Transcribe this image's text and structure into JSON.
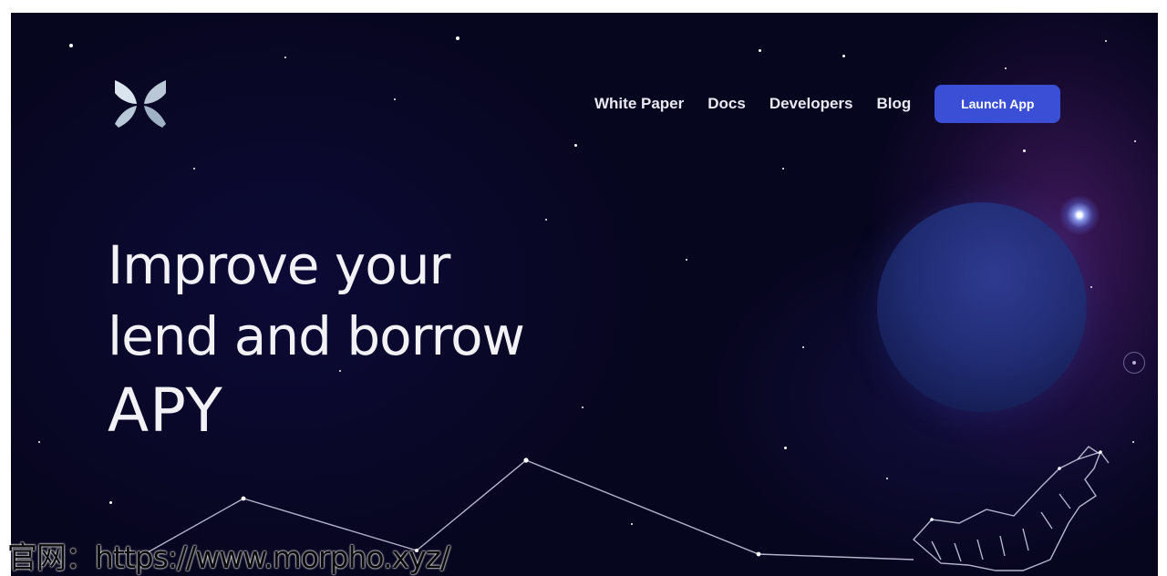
{
  "brand": {
    "logo_icon": "butterfly-logo-icon"
  },
  "nav": {
    "items": [
      {
        "label": "White Paper"
      },
      {
        "label": "Docs"
      },
      {
        "label": "Developers"
      },
      {
        "label": "Blog"
      }
    ],
    "cta_label": "Launch App"
  },
  "hero": {
    "line1": "Improve your",
    "line2": "lend and borrow",
    "line3": "APY"
  },
  "caption": "官网：https://www.morpho.xyz/",
  "colors": {
    "background": "#080722",
    "cta": "#3b4fd6",
    "text": "#f1f1f6"
  }
}
